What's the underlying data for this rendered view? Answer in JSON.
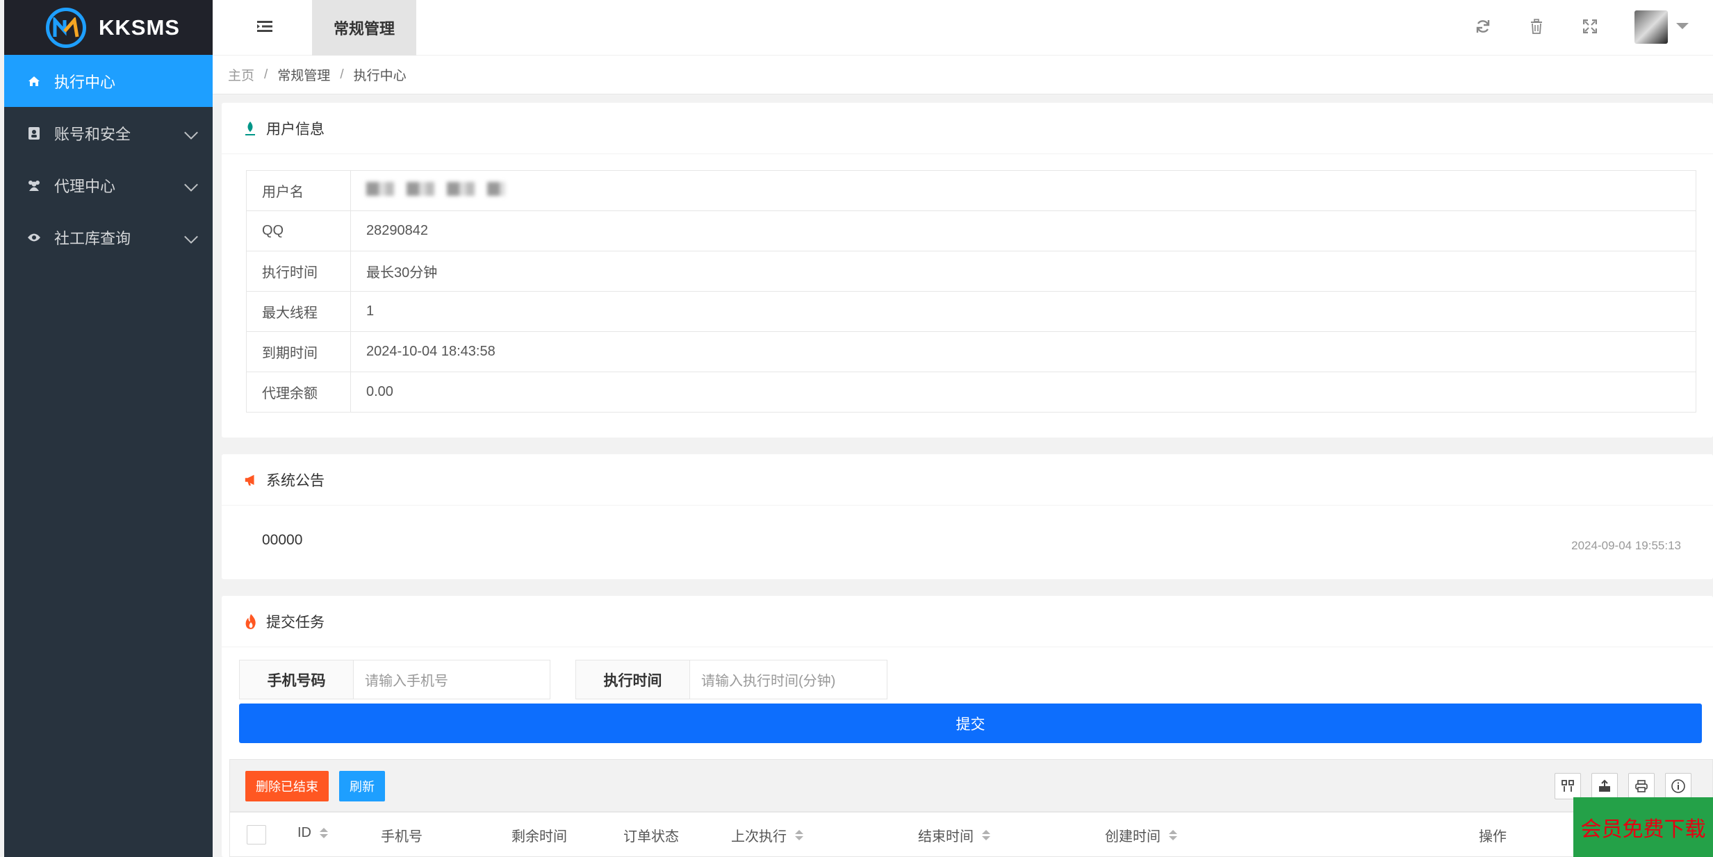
{
  "app": {
    "name": "KKSMS"
  },
  "sidebar": {
    "items": [
      {
        "label": "执行中心",
        "icon": "home-icon",
        "active": true
      },
      {
        "label": "账号和安全",
        "icon": "contact-card-icon"
      },
      {
        "label": "代理中心",
        "icon": "users-icon"
      },
      {
        "label": "社工库查询",
        "icon": "eye-icon"
      }
    ]
  },
  "header": {
    "tab": "常规管理",
    "icons": [
      "menu-toggle-icon",
      "refresh-icon",
      "trash-icon",
      "fullscreen-icon"
    ]
  },
  "breadcrumb": {
    "home": "主页",
    "section": "常规管理",
    "current": "执行中心"
  },
  "user_info": {
    "title": "用户信息",
    "rows": [
      {
        "label": "用户名",
        "value": ""
      },
      {
        "label": "QQ",
        "value": "28290842"
      },
      {
        "label": "执行时间",
        "value": "最长30分钟"
      },
      {
        "label": "最大线程",
        "value": "1"
      },
      {
        "label": "到期时间",
        "value": "2024-10-04 18:43:58"
      },
      {
        "label": "代理余额",
        "value": "0.00"
      }
    ]
  },
  "notice": {
    "title": "系统公告",
    "content": "00000",
    "time": "2024-09-04 19:55:13"
  },
  "task": {
    "title": "提交任务",
    "phone_label": "手机号码",
    "phone_placeholder": "请输入手机号",
    "time_label": "执行时间",
    "time_placeholder": "请输入执行时间(分钟)",
    "submit": "提交"
  },
  "table": {
    "delete_btn": "删除已结束",
    "refresh_btn": "刷新",
    "tool_icons": [
      "columns-icon",
      "export-icon",
      "print-icon",
      "info-icon"
    ],
    "columns": [
      "ID",
      "手机号",
      "剩余时间",
      "订单状态",
      "上次执行",
      "结束时间",
      "创建时间",
      "操作"
    ]
  },
  "promo": "会员免费下载",
  "colors": {
    "primary": "#1e9fff",
    "submit": "#0d6efd",
    "danger": "#ff5722",
    "sidebar": "#28333e"
  }
}
